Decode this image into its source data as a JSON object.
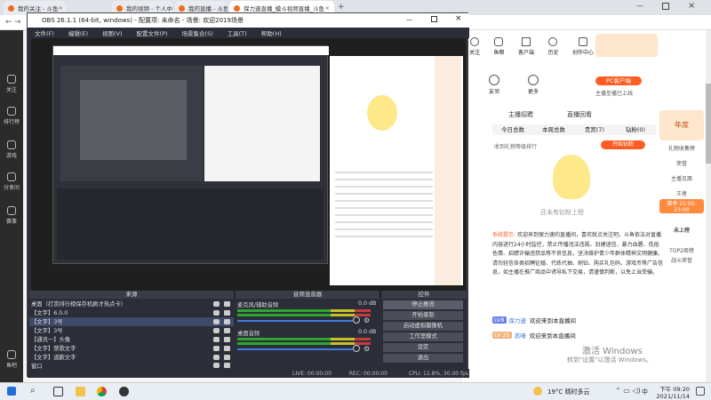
{
  "browser": {
    "tabs": [
      {
        "label": "我的关注 - 斗鱼"
      },
      {
        "label": "我的视频 - 个人中心 - 斗鱼"
      },
      {
        "label": "我的直播 - 斗鱼"
      },
      {
        "label": "保力速直播_模斗视频直播_斗鱼"
      }
    ]
  },
  "sidebar": {
    "items": [
      {
        "label": "关注"
      },
      {
        "label": "排行榜"
      },
      {
        "label": "游戏"
      },
      {
        "label": "分享间"
      },
      {
        "label": "赛事"
      },
      {
        "label": "鱼吧"
      }
    ]
  },
  "page": {
    "top_icons": [
      {
        "label": "关注"
      },
      {
        "label": "鱼粮"
      },
      {
        "label": "客户端"
      },
      {
        "label": "历史"
      },
      {
        "label": "创作中心"
      }
    ],
    "follow_row": [
      {
        "label": "友邻"
      },
      {
        "label": "更多"
      }
    ],
    "pc_badge": "PC客户端",
    "live_tip": "主播至播已上线",
    "section_tabs": [
      "主播招聘",
      "直播回看"
    ],
    "rank_tabs": [
      "今日总数",
      "本周总数",
      "贵宾(7)",
      "钻粉(0)"
    ],
    "rank_title": "收到礼物等级排行",
    "rank_btn": "开始钻粉",
    "empty_text": "还未有钻粉上榜",
    "sys_notice": "系统提示:",
    "notice_text": "欢迎来到保力速的直播间，喜欢就点关注吧。斗鱼依法对直播内容进行24小时监控，禁止传播违法违规、封建迷信、暴力血腥、低俗色情、招嫖诈骗违禁品等不良信息，坚决维护青少年群体精神文明健康。请勿轻信各类招聘征婚、代练代抽、刷钻、购买礼包码、游戏币等广告信息，如主播在推广商品中诱导私下交易，请谨慎判断，以免上当受骗。",
    "chat": [
      {
        "badge": "LV8",
        "user": "保力速",
        "text": "欢迎来到本直播间"
      },
      {
        "badge": "LV 25",
        "user": "哀嚎",
        "text": "欢迎来到本直播间"
      }
    ],
    "right_promo": [
      "年度",
      "礼物收集榜",
      "荣誉",
      "主播见面",
      "王者",
      "赛季 21:00-23:00",
      "未上榜",
      "TOP2周榜",
      "战斗荣誉"
    ]
  },
  "obs": {
    "title": "OBS 26.1.1 (64-bit, windows) - 配置项: 未命名 - 场景: 欢迎2019场景",
    "menu": [
      "文件(F)",
      "编辑(E)",
      "视图(V)",
      "配置文件(P)",
      "场景集合(S)",
      "工具(T)",
      "帮助(H)"
    ],
    "sources_header": "来源",
    "mixer_header": "音频混音器",
    "controls_header": "控件",
    "sources": [
      {
        "label": "桌面（打赏排行榜保存机刷才热点卡）",
        "selected": false
      },
      {
        "label": "【文字】6.0.0",
        "selected": false
      },
      {
        "label": "【文字】3号",
        "selected": true
      },
      {
        "label": "【文字】3号",
        "selected": false
      },
      {
        "label": "【通讯一】头像",
        "selected": false
      },
      {
        "label": "【文字】禁歌文字",
        "selected": false
      },
      {
        "label": "【文字】道歉文字",
        "selected": false
      },
      {
        "label": "窗口",
        "selected": false
      }
    ],
    "mixer": [
      {
        "label": "麦克风/辅助音频",
        "db": "0.0 dB"
      },
      {
        "label": "桌面音频",
        "db": "0.0 dB"
      }
    ],
    "controls": [
      {
        "label": "停止推流",
        "active": true
      },
      {
        "label": "开始录制",
        "active": false
      },
      {
        "label": "启动虚拟摄像机",
        "active": false
      },
      {
        "label": "工作室模式",
        "active": false
      },
      {
        "label": "设定",
        "active": false
      },
      {
        "label": "退出",
        "active": false
      }
    ],
    "status": {
      "live": "LIVE: 00:00:00",
      "rec": "REC: 00:00:00",
      "cpu": "CPU: 12.8%, 30.00 fps"
    }
  },
  "taskbar": {
    "weather": "19°C 晴时多云",
    "time": "下午 09:20",
    "date": "2021/11/14",
    "lang": "中"
  },
  "watermark": {
    "line1": "激活 Windows",
    "line2": "转到\"设置\"以激活 Windows。"
  },
  "colors": {
    "accent": "#ff5d23",
    "obs_bg": "#2b2e38",
    "obs_sel": "#3f4a69"
  }
}
